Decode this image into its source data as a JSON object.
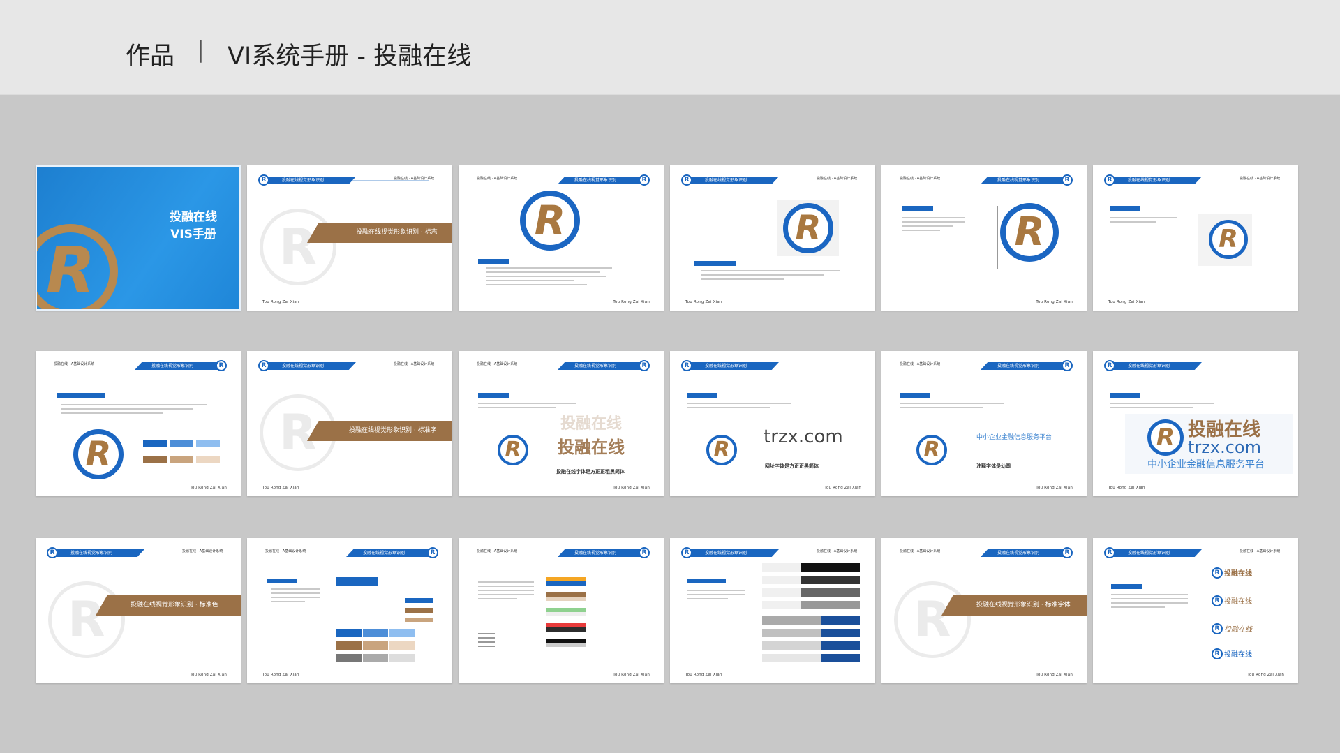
{
  "header": {
    "work": "作品",
    "sep": "|",
    "title": "VI系统手册 - 投融在线"
  },
  "pages": {
    "cover_title_1": "投融在线",
    "cover_title_2": "VIS手册",
    "bar_title": "投融在线视觉形象识别",
    "bar_right": "投融在线 · A基础设计系统",
    "footer": "Tou Rong Zai Xian",
    "section_logo": "投融在线视觉形象识别 · 标志",
    "section_font": "投融在线视觉形象识别 · 标准字",
    "section_color": "投融在线视觉形象识别 · 标准色",
    "section_type": "投融在线视觉形象识别 · 标准字体",
    "logo_mark": "R",
    "brand_cn": "投融在线",
    "brand_url": "trzx.com",
    "slogan": "中小企业金融信息服务平台",
    "cap_cn_font": "投融在线字体是方正正粗黑简体",
    "cap_url_font": "网址字体是方正正黑简体",
    "cap_slogan_font": "注释字体是幼圆"
  },
  "colors": {
    "blue": "#1a66c0",
    "brown": "#9b7147",
    "cover": "#2b97e6"
  }
}
